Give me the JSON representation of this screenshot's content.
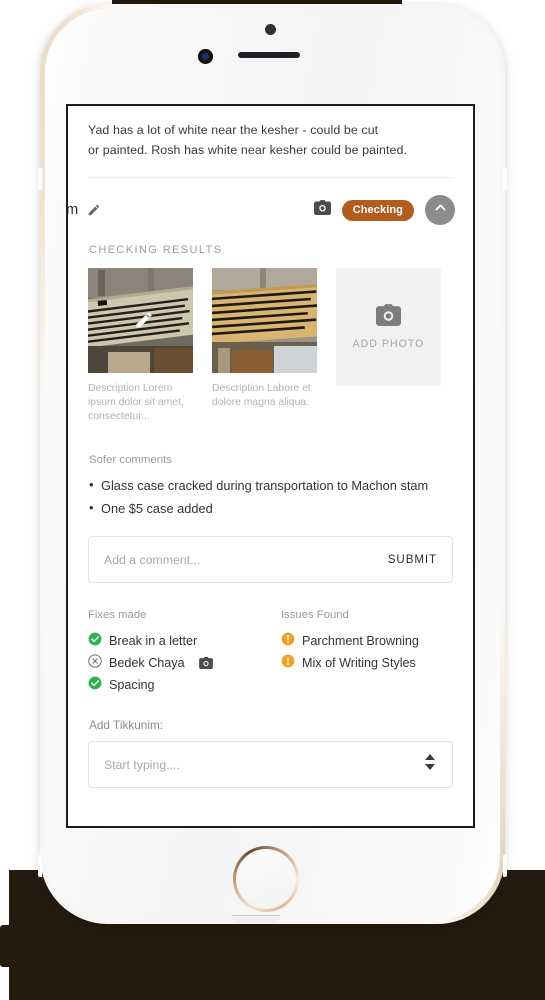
{
  "device": {
    "frame": "iphone-gold-white",
    "sensor_icon": "proximity-sensor",
    "camera_icon": "front-camera",
    "speaker_icon": "earpiece-speaker",
    "home_icon": "home-button"
  },
  "note": {
    "line1": "Yad has a lot of white near the kesher - could be cut",
    "line2": "or painted. Rosh has white near kesher could be painted."
  },
  "header": {
    "title": "om",
    "edit_icon": "pencil-icon",
    "camera_icon": "camera-icon",
    "status_badge": "Checking",
    "badge_color": "#b25c1e",
    "collapse_icon": "chevron-up-icon"
  },
  "checking_results": {
    "caption": "CHECKING RESULTS",
    "photos": [
      {
        "alt": "torah-scroll-photo-1",
        "description": "Description Lorem ipsum dolor sit amet, consectetur...",
        "overlay_icon": "pencil-icon"
      },
      {
        "alt": "torah-scroll-photo-2",
        "description": "Description  Labore et dolore magna aliqua.",
        "overlay_icon": null
      }
    ],
    "add_photo": {
      "label": "ADD PHOTO",
      "icon": "camera-icon"
    }
  },
  "sofer": {
    "label": "Sofer comments",
    "comments": [
      "Glass case cracked during transportation to Machon stam",
      "One $5 case  added"
    ],
    "input": {
      "value": "",
      "placeholder": "Add a comment...",
      "submit_label": "SUBMIT"
    }
  },
  "fixes": {
    "heading": "Fixes made",
    "items": [
      {
        "label": "Break in a letter",
        "icon": "check-circle-icon",
        "color": "#2eb24d",
        "extra_icon": null
      },
      {
        "label": "Bedek Chaya",
        "icon": "x-circle-icon",
        "color": "#777777",
        "extra_icon": "camera-icon"
      },
      {
        "label": "Spacing",
        "icon": "check-circle-icon",
        "color": "#2eb24d",
        "extra_icon": null
      }
    ]
  },
  "issues": {
    "heading": "Issues Found",
    "items": [
      {
        "label": "Parchment Browning",
        "icon": "alert-circle-icon",
        "color": "#f0a023"
      },
      {
        "label": "Mix of Writing Styles",
        "icon": "alert-circle-icon",
        "color": "#f0a023"
      }
    ]
  },
  "tikkunim": {
    "label": "Add Tikkunim:",
    "input": {
      "value": "",
      "placeholder": "Start typing....",
      "stepper_icon": "up-down-arrows-icon"
    }
  }
}
